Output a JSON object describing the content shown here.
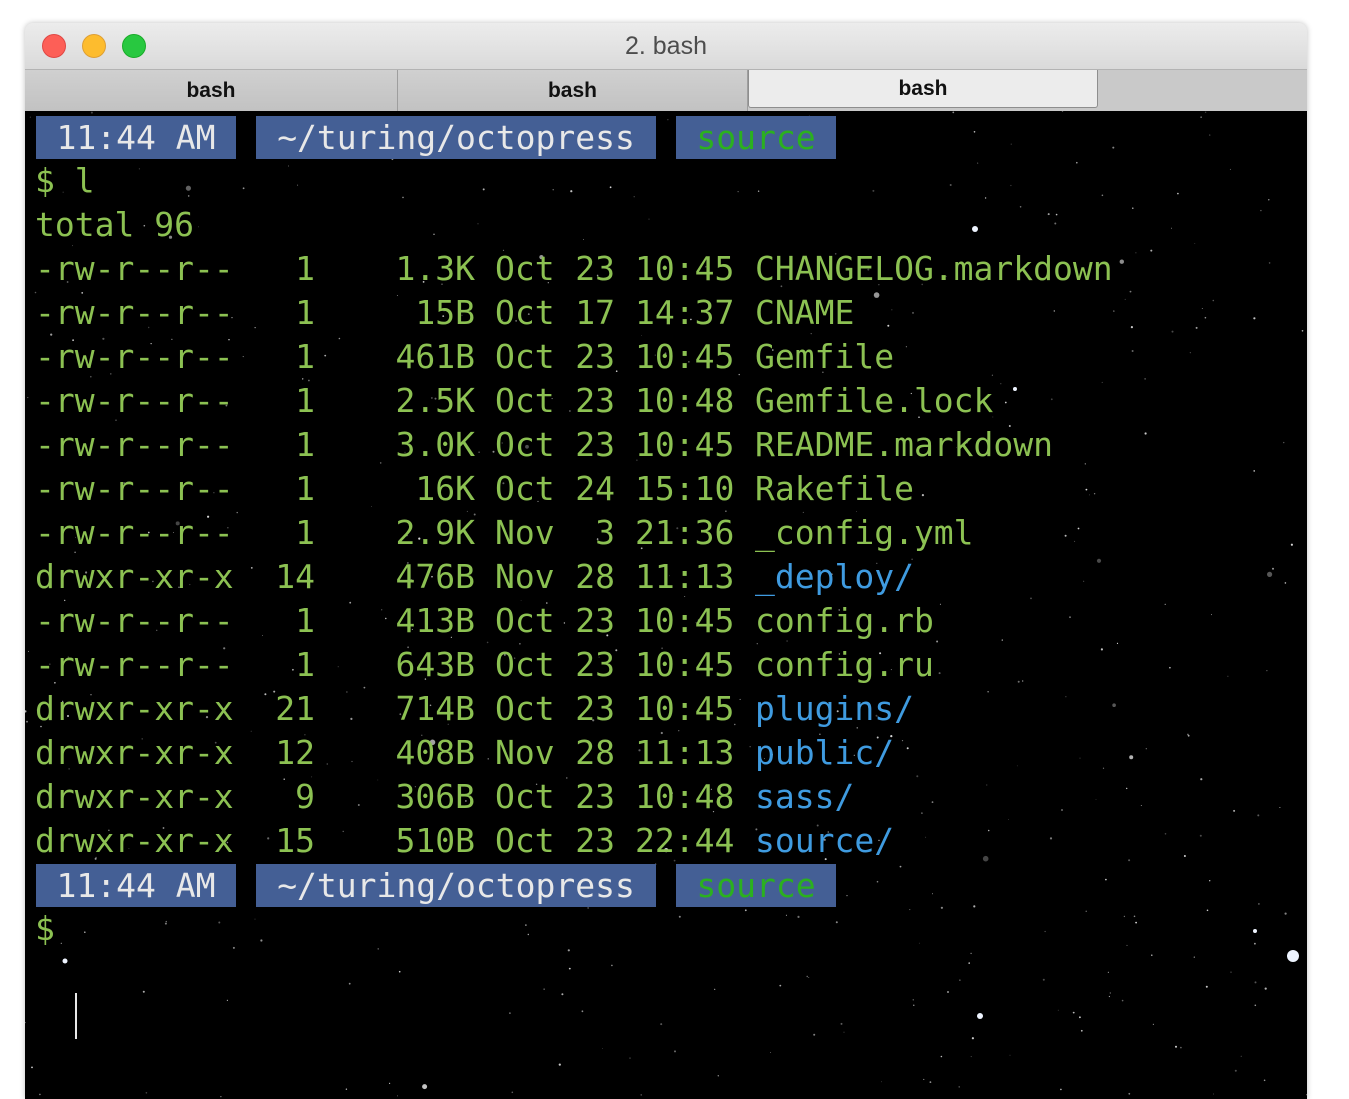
{
  "window": {
    "title": "2. bash"
  },
  "tabs": [
    {
      "label": "bash",
      "active": false
    },
    {
      "label": "bash",
      "active": false
    },
    {
      "label": "bash",
      "active": true
    }
  ],
  "prompt": {
    "time": "11:44 AM",
    "path": "~/turing/octopress",
    "branch": "source"
  },
  "command": "$ l",
  "total": "total 96",
  "listing": [
    {
      "perms": "-rw-r--r--",
      "links": "1",
      "size": "1.3K",
      "month": "Oct",
      "day": "23",
      "time": "10:45",
      "name": "CHANGELOG.markdown",
      "is_dir": false
    },
    {
      "perms": "-rw-r--r--",
      "links": "1",
      "size": "15B",
      "month": "Oct",
      "day": "17",
      "time": "14:37",
      "name": "CNAME",
      "is_dir": false
    },
    {
      "perms": "-rw-r--r--",
      "links": "1",
      "size": "461B",
      "month": "Oct",
      "day": "23",
      "time": "10:45",
      "name": "Gemfile",
      "is_dir": false
    },
    {
      "perms": "-rw-r--r--",
      "links": "1",
      "size": "2.5K",
      "month": "Oct",
      "day": "23",
      "time": "10:48",
      "name": "Gemfile.lock",
      "is_dir": false
    },
    {
      "perms": "-rw-r--r--",
      "links": "1",
      "size": "3.0K",
      "month": "Oct",
      "day": "23",
      "time": "10:45",
      "name": "README.markdown",
      "is_dir": false
    },
    {
      "perms": "-rw-r--r--",
      "links": "1",
      "size": "16K",
      "month": "Oct",
      "day": "24",
      "time": "15:10",
      "name": "Rakefile",
      "is_dir": false
    },
    {
      "perms": "-rw-r--r--",
      "links": "1",
      "size": "2.9K",
      "month": "Nov",
      "day": "3",
      "time": "21:36",
      "name": "_config.yml",
      "is_dir": false
    },
    {
      "perms": "drwxr-xr-x",
      "links": "14",
      "size": "476B",
      "month": "Nov",
      "day": "28",
      "time": "11:13",
      "name": "_deploy/",
      "is_dir": true
    },
    {
      "perms": "-rw-r--r--",
      "links": "1",
      "size": "413B",
      "month": "Oct",
      "day": "23",
      "time": "10:45",
      "name": "config.rb",
      "is_dir": false
    },
    {
      "perms": "-rw-r--r--",
      "links": "1",
      "size": "643B",
      "month": "Oct",
      "day": "23",
      "time": "10:45",
      "name": "config.ru",
      "is_dir": false
    },
    {
      "perms": "drwxr-xr-x",
      "links": "21",
      "size": "714B",
      "month": "Oct",
      "day": "23",
      "time": "10:45",
      "name": "plugins/",
      "is_dir": true
    },
    {
      "perms": "drwxr-xr-x",
      "links": "12",
      "size": "408B",
      "month": "Nov",
      "day": "28",
      "time": "11:13",
      "name": "public/",
      "is_dir": true
    },
    {
      "perms": "drwxr-xr-x",
      "links": "9",
      "size": "306B",
      "month": "Oct",
      "day": "23",
      "time": "10:48",
      "name": "sass/",
      "is_dir": true
    },
    {
      "perms": "drwxr-xr-x",
      "links": "15",
      "size": "510B",
      "month": "Oct",
      "day": "23",
      "time": "22:44",
      "name": "source/",
      "is_dir": true
    }
  ],
  "input_prompt": "$",
  "colors": {
    "text": "#8cc152",
    "directory": "#3f9be0",
    "segment_bg": "#445f95",
    "branch": "#2bb01f"
  }
}
